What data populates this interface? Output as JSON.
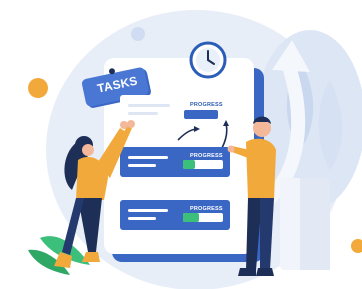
{
  "illustration": {
    "sign_label": "TASKS",
    "cards": [
      {
        "label": "PROGRESS",
        "progress": 0.0
      },
      {
        "label": "PROGRESS",
        "progress": 0.3
      },
      {
        "label": "PROGRESS",
        "progress": 0.4
      }
    ],
    "colors": {
      "primary_blue": "#3a66c4",
      "accent_yellow": "#f2a93b",
      "accent_green": "#3bbf7a",
      "dark_navy": "#1e2f57",
      "backdrop": "#e8eef8"
    },
    "icons": [
      "clock-icon",
      "tasks-sign-icon",
      "arrow-icon",
      "plant-icon"
    ]
  }
}
